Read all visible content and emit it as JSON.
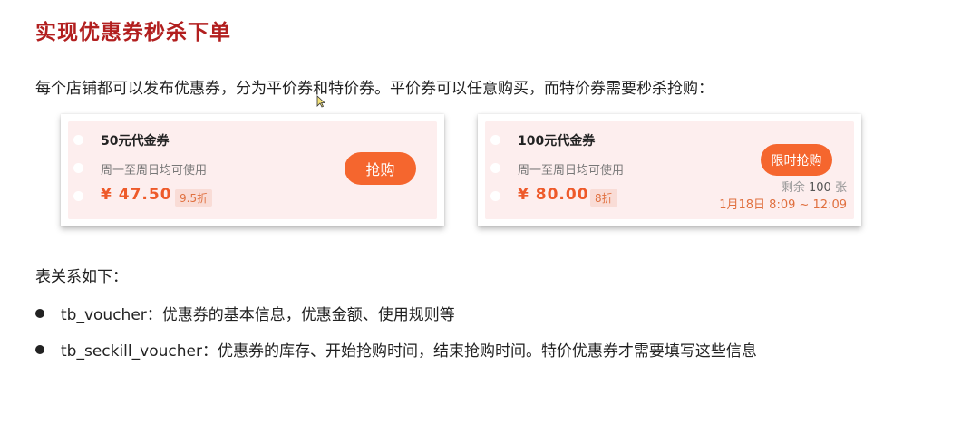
{
  "title": "实现优惠券秒杀下单",
  "intro": "每个店铺都可以发布优惠券，分为平价券和特价券。平价券可以任意购买，而特价券需要秒杀抢购：",
  "vouchers": [
    {
      "name": "50元代金券",
      "rule": "周一至周日均可使用",
      "price": "¥ 47.50",
      "discount": "9.5折",
      "button": "抢购"
    },
    {
      "name": "100元代金券",
      "rule": "周一至周日均可使用",
      "price": "¥ 80.00",
      "discount": "8折",
      "button": "限时抢购",
      "stock_prefix": "剩余",
      "stock_count": "100",
      "stock_unit": "张",
      "time": "1月18日 8:09 ~ 12:09"
    }
  ],
  "relations_heading": "表关系如下：",
  "bullets": [
    "tb_voucher：优惠券的基本信息，优惠金额、使用规则等",
    "tb_seckill_voucher：优惠券的库存、开始抢购时间，结束抢购时间。特价优惠券才需要填写这些信息"
  ],
  "colors": {
    "title": "#b21f1f",
    "accent": "#f5662e",
    "card_bg": "#fdeeee"
  }
}
